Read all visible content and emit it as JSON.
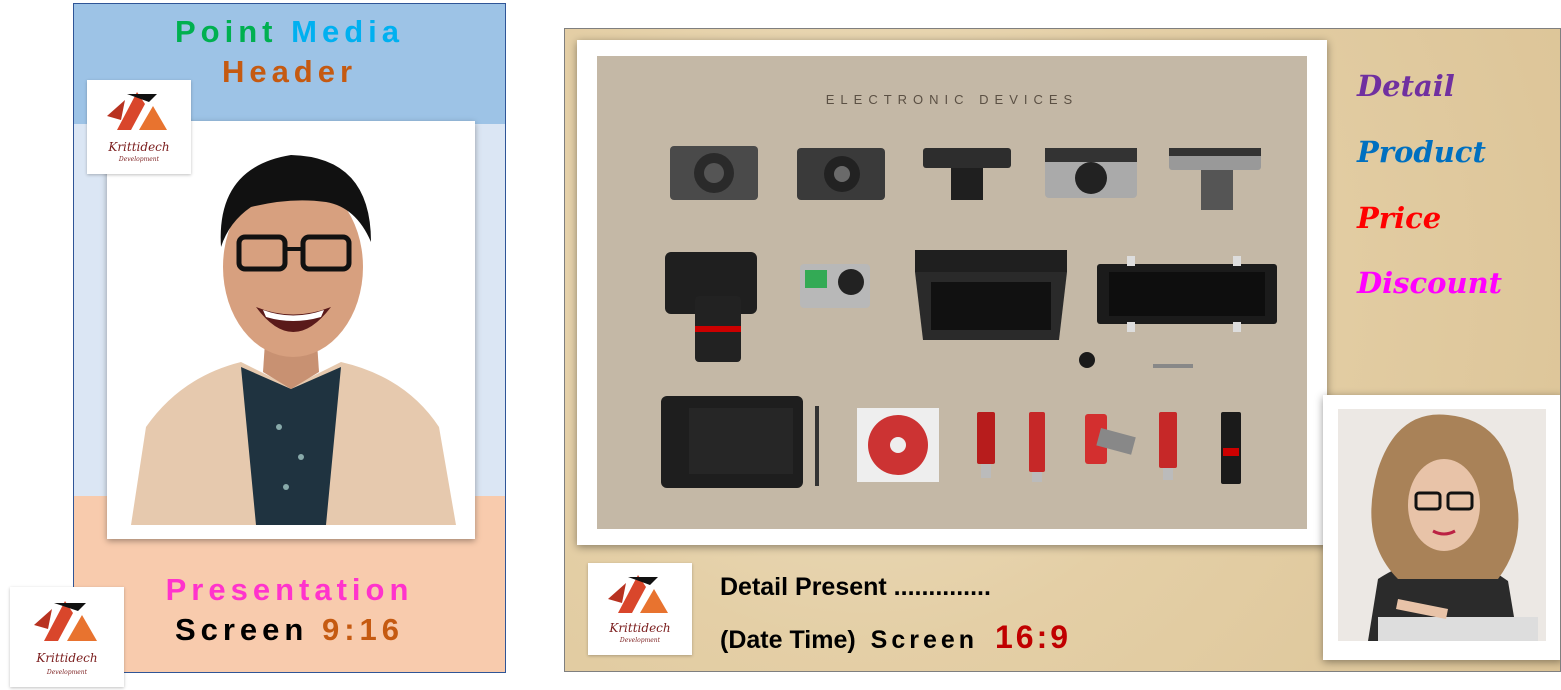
{
  "portrait": {
    "title_word1": "Point",
    "title_word2": "Media",
    "title_line2": "Header",
    "presentation": "Presentation",
    "screen_label": "Screen",
    "ratio": "9:16",
    "colors": {
      "word1": "#00b050",
      "word2": "#00b0f0",
      "header": "#c55a11",
      "presentation": "#ff33cc",
      "ratio": "#c55a11",
      "header_bg": "#9dc3e6",
      "footer_bg": "#f8cbad"
    }
  },
  "logo": {
    "text": "Krittidech",
    "subtext": "Development"
  },
  "landscape": {
    "devices_heading": "ELECTRONIC DEVICES",
    "side_items": [
      {
        "label": "Detail",
        "color": "#7030a0"
      },
      {
        "label": "Product",
        "color": "#0070c0"
      },
      {
        "label": "Price",
        "color": "#ff0000"
      },
      {
        "label": "Discount",
        "color": "#ff00ff"
      }
    ],
    "detail_line": "Detail Present ..............",
    "date_line": "(Date Time)",
    "screen_label": "Screen",
    "ratio": "16:9",
    "ratio_color": "#c00000"
  }
}
